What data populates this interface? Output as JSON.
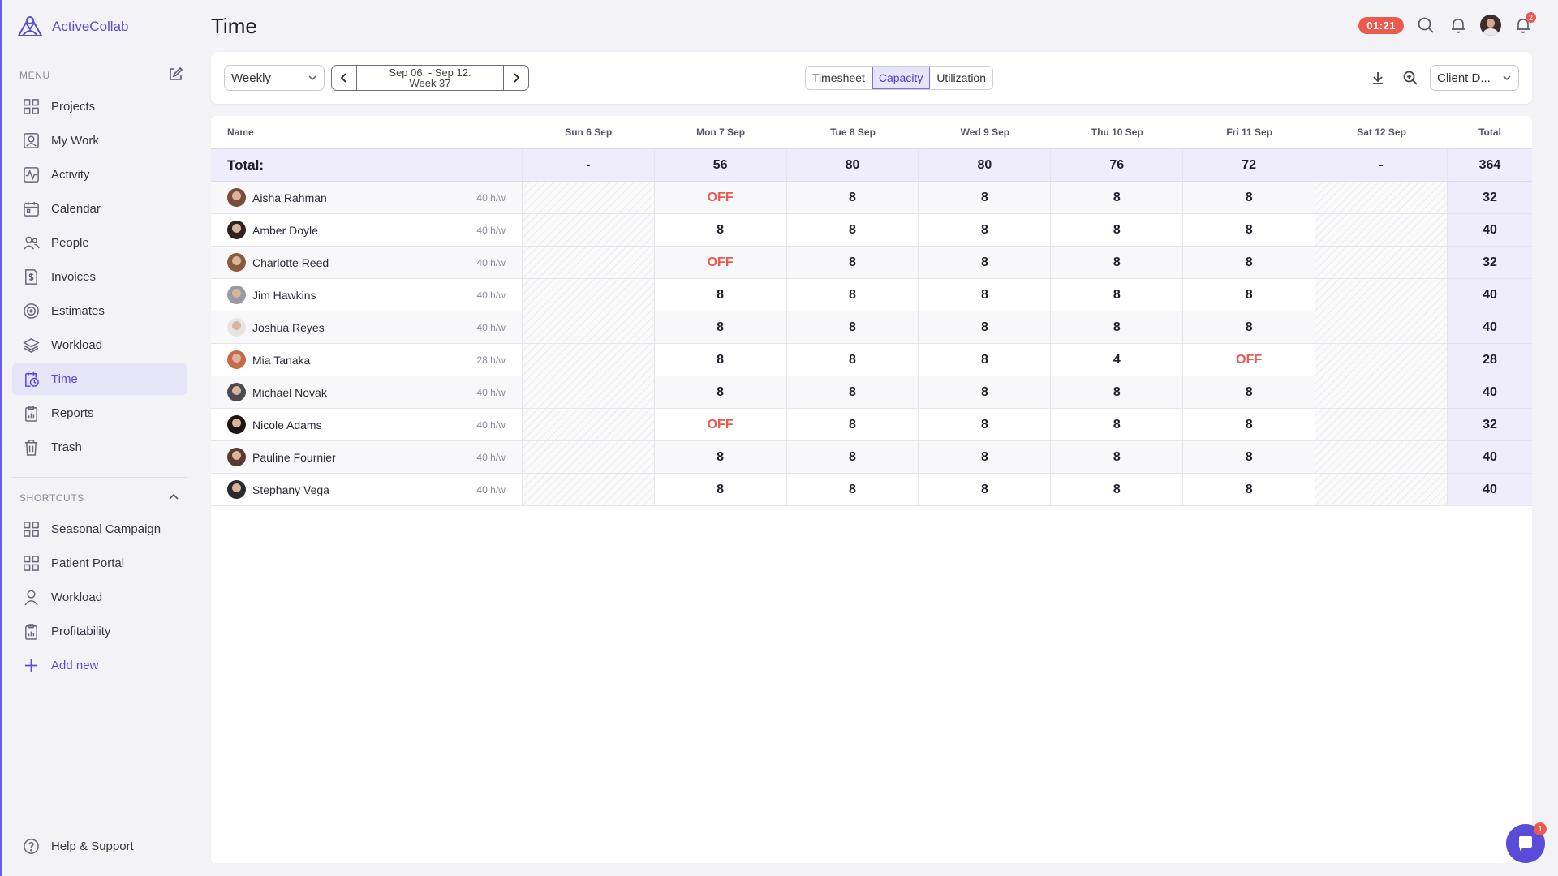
{
  "app": {
    "name": "ActiveCollab",
    "brand_color": "#5a4bd9"
  },
  "sidebar": {
    "menu_label": "MENU",
    "items": [
      {
        "label": "Projects",
        "icon": "grid-icon"
      },
      {
        "label": "My Work",
        "icon": "user-square-icon"
      },
      {
        "label": "Activity",
        "icon": "activity-icon"
      },
      {
        "label": "Calendar",
        "icon": "calendar-icon"
      },
      {
        "label": "People",
        "icon": "people-icon"
      },
      {
        "label": "Invoices",
        "icon": "invoice-icon"
      },
      {
        "label": "Estimates",
        "icon": "target-icon"
      },
      {
        "label": "Workload",
        "icon": "layers-icon"
      },
      {
        "label": "Time",
        "icon": "timesheet-icon",
        "active": true
      },
      {
        "label": "Reports",
        "icon": "clipboard-icon"
      },
      {
        "label": "Trash",
        "icon": "trash-icon"
      }
    ],
    "shortcuts_label": "SHORTCUTS",
    "shortcuts": [
      {
        "label": "Seasonal Campaign",
        "icon": "grid-icon"
      },
      {
        "label": "Patient Portal",
        "icon": "grid-icon"
      },
      {
        "label": "Workload",
        "icon": "user-icon"
      },
      {
        "label": "Profitability",
        "icon": "clipboard-icon"
      }
    ],
    "add_new": "Add new",
    "help": "Help & Support"
  },
  "header": {
    "title": "Time",
    "timer": "01:21",
    "notifications_count": "2"
  },
  "toolbar": {
    "period": "Weekly",
    "range_line1": "Sep 06. - Sep 12.",
    "range_line2": "Week 37",
    "tabs": [
      "Timesheet",
      "Capacity",
      "Utilization"
    ],
    "active_tab": "Capacity",
    "client_filter": "Client D..."
  },
  "table": {
    "headers": [
      "Name",
      "Sun 6 Sep",
      "Mon 7 Sep",
      "Tue 8 Sep",
      "Wed 9 Sep",
      "Thu 10 Sep",
      "Fri 11 Sep",
      "Sat 12 Sep",
      "Total"
    ],
    "total_row": {
      "label": "Total:",
      "values": [
        "-",
        "56",
        "80",
        "80",
        "76",
        "72",
        "-",
        "364"
      ]
    },
    "rows": [
      {
        "name": "Aisha Rahman",
        "rate": "40 h/w",
        "values": [
          "",
          "OFF",
          "8",
          "8",
          "8",
          "8",
          ""
        ],
        "total": "32",
        "avatar_color": "#7a4a3a"
      },
      {
        "name": "Amber Doyle",
        "rate": "40 h/w",
        "values": [
          "",
          "8",
          "8",
          "8",
          "8",
          "8",
          ""
        ],
        "total": "40",
        "avatar_color": "#2d2220"
      },
      {
        "name": "Charlotte Reed",
        "rate": "40 h/w",
        "values": [
          "",
          "OFF",
          "8",
          "8",
          "8",
          "8",
          ""
        ],
        "total": "32",
        "avatar_color": "#8a5a3c"
      },
      {
        "name": "Jim Hawkins",
        "rate": "40 h/w",
        "values": [
          "",
          "8",
          "8",
          "8",
          "8",
          "8",
          ""
        ],
        "total": "40",
        "avatar_color": "#9a9aa4"
      },
      {
        "name": "Joshua Reyes",
        "rate": "40 h/w",
        "values": [
          "",
          "8",
          "8",
          "8",
          "8",
          "8",
          ""
        ],
        "total": "40",
        "avatar_color": "#e8e4e0"
      },
      {
        "name": "Mia Tanaka",
        "rate": "28 h/w",
        "values": [
          "",
          "8",
          "8",
          "8",
          "4",
          "OFF",
          ""
        ],
        "total": "28",
        "avatar_color": "#c76a4a"
      },
      {
        "name": "Michael Novak",
        "rate": "40 h/w",
        "values": [
          "",
          "8",
          "8",
          "8",
          "8",
          "8",
          ""
        ],
        "total": "40",
        "avatar_color": "#4a4a50"
      },
      {
        "name": "Nicole Adams",
        "rate": "40 h/w",
        "values": [
          "",
          "OFF",
          "8",
          "8",
          "8",
          "8",
          ""
        ],
        "total": "32",
        "avatar_color": "#1e1614"
      },
      {
        "name": "Pauline Fournier",
        "rate": "40 h/w",
        "values": [
          "",
          "8",
          "8",
          "8",
          "8",
          "8",
          ""
        ],
        "total": "40",
        "avatar_color": "#5a3a30"
      },
      {
        "name": "Stephany Vega",
        "rate": "40 h/w",
        "values": [
          "",
          "8",
          "8",
          "8",
          "8",
          "8",
          ""
        ],
        "total": "40",
        "avatar_color": "#2a2a2e"
      }
    ]
  },
  "chat": {
    "badge": "1"
  }
}
